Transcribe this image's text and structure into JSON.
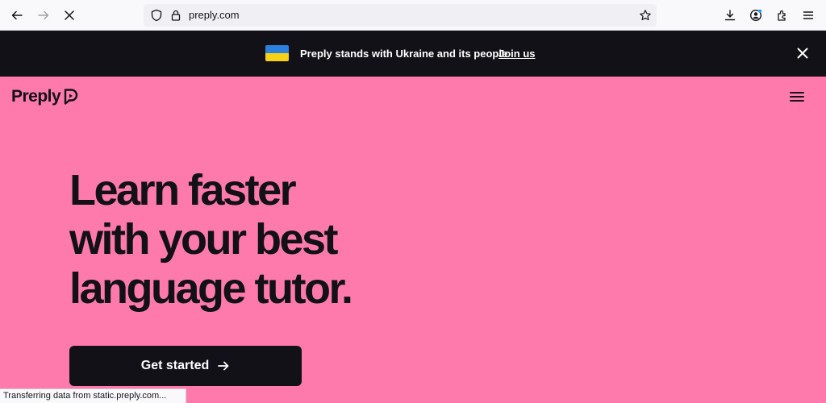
{
  "browser": {
    "url": "preply.com",
    "icons": [
      "back-icon",
      "forward-icon",
      "stop-icon",
      "shield-icon",
      "lock-icon",
      "star-icon",
      "download-icon",
      "account-icon",
      "extensions-icon",
      "menu-icon"
    ]
  },
  "banner": {
    "text": "Preply stands with Ukraine and its people",
    "link": "Join us",
    "flag_colors": [
      "#2c7fdc",
      "#f7d117"
    ]
  },
  "header": {
    "logo_text": "Preply"
  },
  "hero": {
    "lines": [
      "Learn faster",
      "with your best",
      "language tutor."
    ],
    "cta_label": "Get started"
  },
  "status": {
    "text": "Transferring data from static.preply.com..."
  },
  "colors": {
    "background": "#ff7aac",
    "dark": "#121117"
  }
}
